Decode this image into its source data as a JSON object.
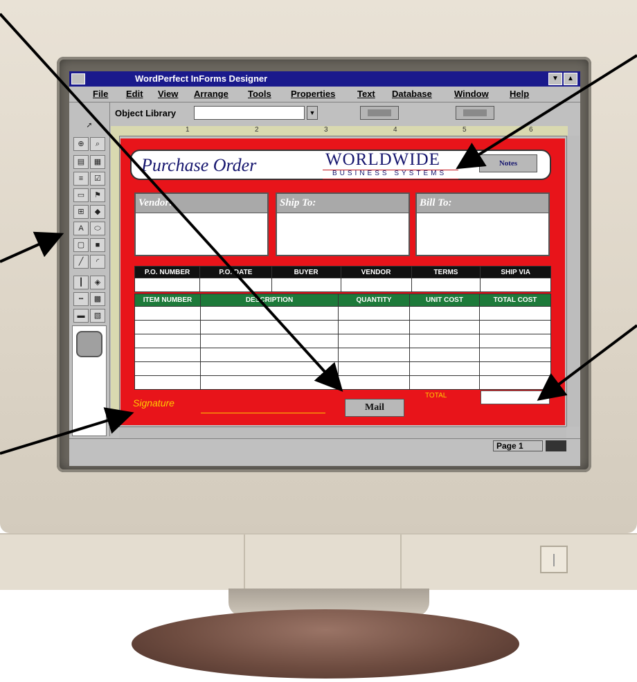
{
  "window": {
    "title": "WordPerfect InForms Designer"
  },
  "menu": [
    "File",
    "Edit",
    "View",
    "Arrange",
    "Tools",
    "Properties",
    "Text",
    "Database",
    "Window",
    "Help"
  ],
  "toolbar": {
    "object_library_label": "Object Library",
    "object_library_value": ""
  },
  "ruler": [
    "1",
    "2",
    "3",
    "4",
    "5",
    "6"
  ],
  "form": {
    "title": "Purchase Order",
    "logo_main": "WORLDWIDE",
    "logo_sub": "BUSINESS SYSTEMS",
    "notes_label": "Notes",
    "address_boxes": [
      "Vendor:",
      "Ship To:",
      "Bill To:"
    ],
    "order_headers": [
      "P.O. NUMBER",
      "P.O. DATE",
      "BUYER",
      "VENDOR",
      "TERMS",
      "SHIP VIA"
    ],
    "item_headers": [
      "ITEM NUMBER",
      "DESCRIPTION",
      "QUANTITY",
      "UNIT COST",
      "TOTAL COST"
    ],
    "item_rows": 6,
    "signature_label": "Signature",
    "mail_label": "Mail",
    "total_label": "TOTAL"
  },
  "status": {
    "page": "Page 1"
  },
  "colors": {
    "form_bg": "#e8141a",
    "title_bar": "#1a1a8c",
    "order_header_bg": "#111111",
    "item_header_bg": "#1d7a3a",
    "accent_yellow": "#ffcc00"
  }
}
